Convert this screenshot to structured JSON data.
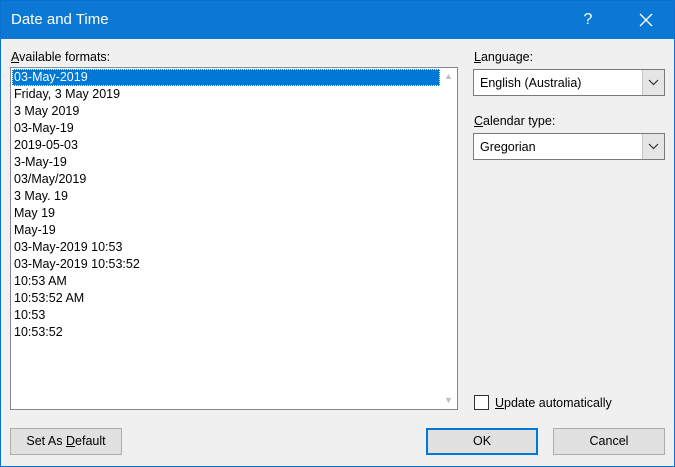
{
  "window": {
    "title": "Date and Time",
    "help_label": "?"
  },
  "formats": {
    "label_accel": "A",
    "label_rest": "vailable formats:",
    "items": [
      {
        "text": "03-May-2019",
        "selected": true
      },
      {
        "text": "Friday, 3 May 2019",
        "selected": false
      },
      {
        "text": "3 May 2019",
        "selected": false
      },
      {
        "text": "03-May-19",
        "selected": false
      },
      {
        "text": "2019-05-03",
        "selected": false
      },
      {
        "text": "3-May-19",
        "selected": false
      },
      {
        "text": "03/May/2019",
        "selected": false
      },
      {
        "text": "3 May. 19",
        "selected": false
      },
      {
        "text": "May 19",
        "selected": false
      },
      {
        "text": "May-19",
        "selected": false
      },
      {
        "text": "03-May-2019 10:53",
        "selected": false
      },
      {
        "text": "03-May-2019 10:53:52",
        "selected": false
      },
      {
        "text": "10:53 AM",
        "selected": false
      },
      {
        "text": "10:53:52 AM",
        "selected": false
      },
      {
        "text": "10:53",
        "selected": false
      },
      {
        "text": "10:53:52",
        "selected": false
      }
    ]
  },
  "language": {
    "label_accel": "L",
    "label_rest": "anguage:",
    "value": "English (Australia)"
  },
  "calendar": {
    "label_accel": "C",
    "label_rest": "alendar type:",
    "value": "Gregorian"
  },
  "update": {
    "label_accel": "U",
    "label_rest": "pdate automatically",
    "checked": false
  },
  "buttons": {
    "set_default_pre": "Set As ",
    "set_default_accel": "D",
    "set_default_post": "efault",
    "ok": "OK",
    "cancel": "Cancel"
  },
  "colors": {
    "titlebar": "#0b78d4",
    "selection": "#0078d7",
    "dialog_bg": "#f0f0f0"
  },
  "icons": {
    "close": "close-icon",
    "dropdown": "chevron-down-icon",
    "scroll_up": "scroll-up-arrow-icon",
    "scroll_down": "scroll-down-arrow-icon"
  }
}
